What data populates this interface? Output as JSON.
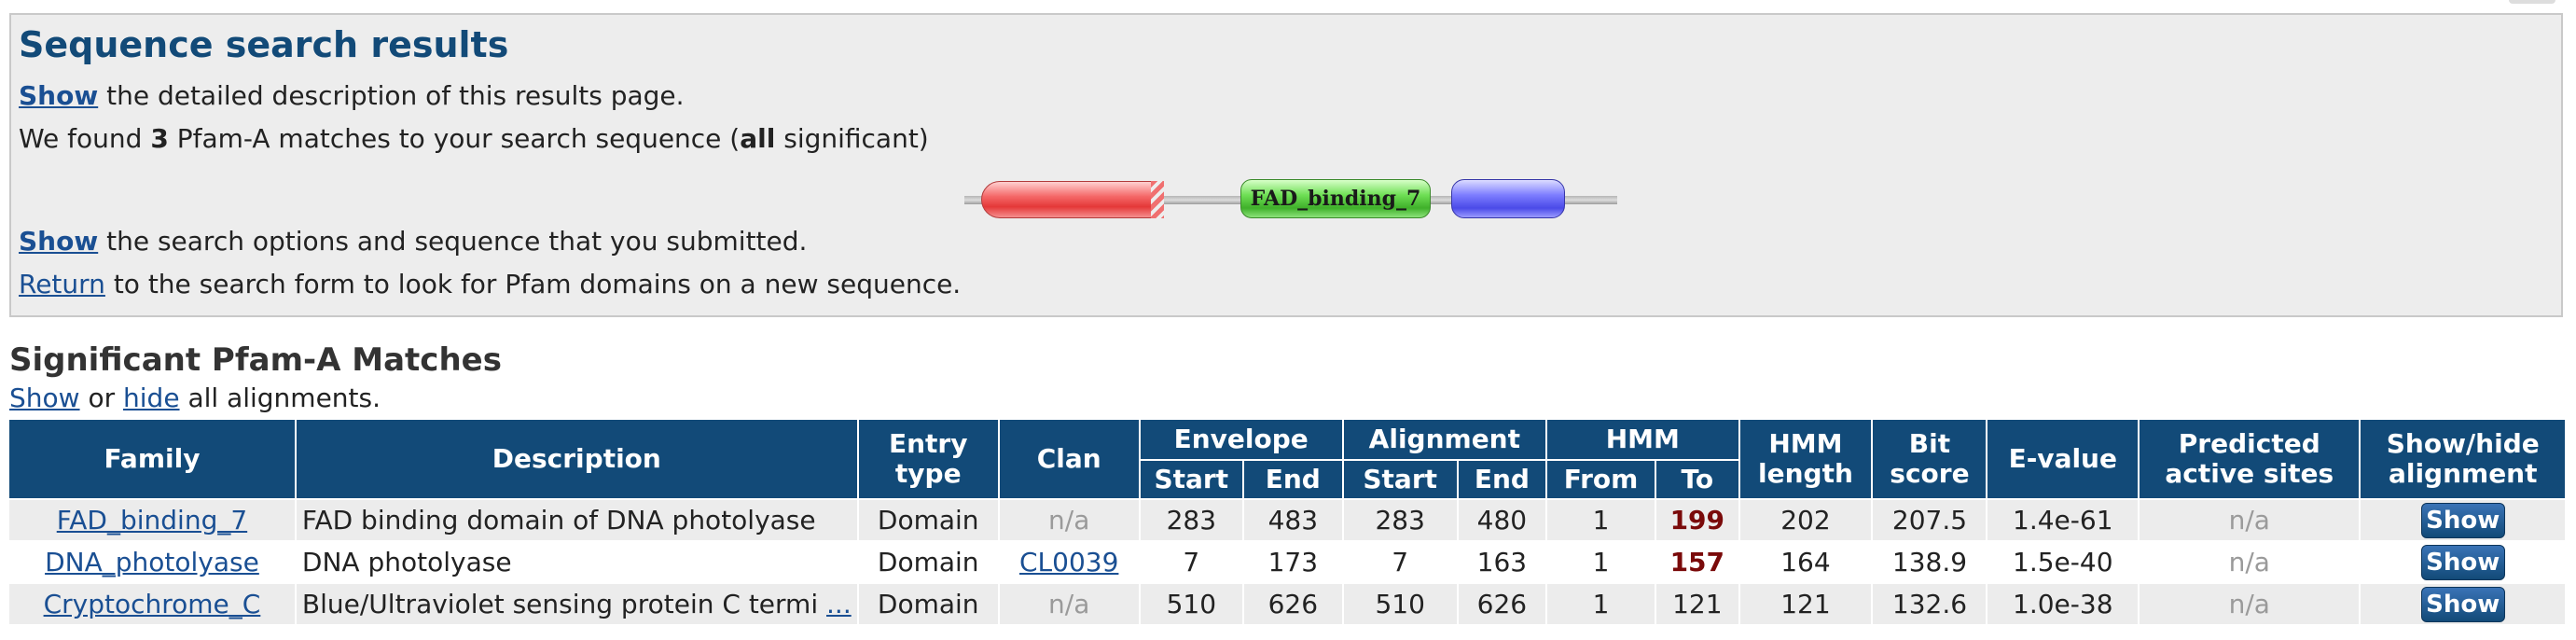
{
  "panel": {
    "title": "Sequence search results",
    "line1": {
      "link": "Show",
      "text": " the detailed description of this results page."
    },
    "line2": {
      "pre": "We found ",
      "count": "3",
      "mid": " Pfam-A matches to your search sequence (",
      "all": "all",
      "post": " significant)"
    },
    "graphic": {
      "green_label": "FAD_binding_7",
      "colors": {
        "red": "#e43838",
        "green": "#3fb02a",
        "blue": "#4a4ae8"
      }
    },
    "line3": {
      "link": "Show",
      "text": " the search options and sequence that you submitted."
    },
    "line4": {
      "link": "Return",
      "text": " to the search form to look for Pfam domains on a new sequence."
    }
  },
  "section": {
    "title": "Significant Pfam-A Matches",
    "show": "Show",
    "or": " or ",
    "hide": "hide",
    "rest": " all alignments."
  },
  "table": {
    "headers": {
      "family": "Family",
      "description": "Description",
      "entry_type_1": "Entry",
      "entry_type_2": "type",
      "clan": "Clan",
      "envelope": "Envelope",
      "alignment": "Alignment",
      "hmm": "HMM",
      "hmm_length_1": "HMM",
      "hmm_length_2": "length",
      "bit_score_1": "Bit",
      "bit_score_2": "score",
      "evalue": "E-value",
      "predicted_1": "Predicted",
      "predicted_2": "active sites",
      "showhide_1": "Show/hide",
      "showhide_2": "alignment",
      "start": "Start",
      "end": "End",
      "from": "From",
      "to": "To"
    },
    "rows": [
      {
        "family": "FAD_binding_7",
        "description": "FAD binding domain of DNA photolyase",
        "type": "Domain",
        "clan": "n/a",
        "env_start": "283",
        "env_end": "483",
        "ali_start": "283",
        "ali_end": "480",
        "hmm_from": "1",
        "hmm_to": "199",
        "hmm_length": "202",
        "bit_score": "207.5",
        "evalue": "1.4e-61",
        "active_sites": "n/a",
        "button": "Show"
      },
      {
        "family": "DNA_photolyase",
        "description": "DNA photolyase",
        "type": "Domain",
        "clan": "CL0039",
        "env_start": "7",
        "env_end": "173",
        "ali_start": "7",
        "ali_end": "163",
        "hmm_from": "1",
        "hmm_to": "157",
        "hmm_length": "164",
        "bit_score": "138.9",
        "evalue": "1.5e-40",
        "active_sites": "n/a",
        "button": "Show"
      },
      {
        "family": "Cryptochrome_C",
        "description": "Blue/Ultraviolet sensing protein C termi",
        "ellipsis": "...",
        "type": "Domain",
        "clan": "n/a",
        "env_start": "510",
        "env_end": "626",
        "ali_start": "510",
        "ali_end": "626",
        "hmm_from": "1",
        "hmm_to": "121",
        "hmm_length": "121",
        "bit_score": "132.6",
        "evalue": "1.0e-38",
        "active_sites": "n/a",
        "button": "Show"
      }
    ]
  }
}
